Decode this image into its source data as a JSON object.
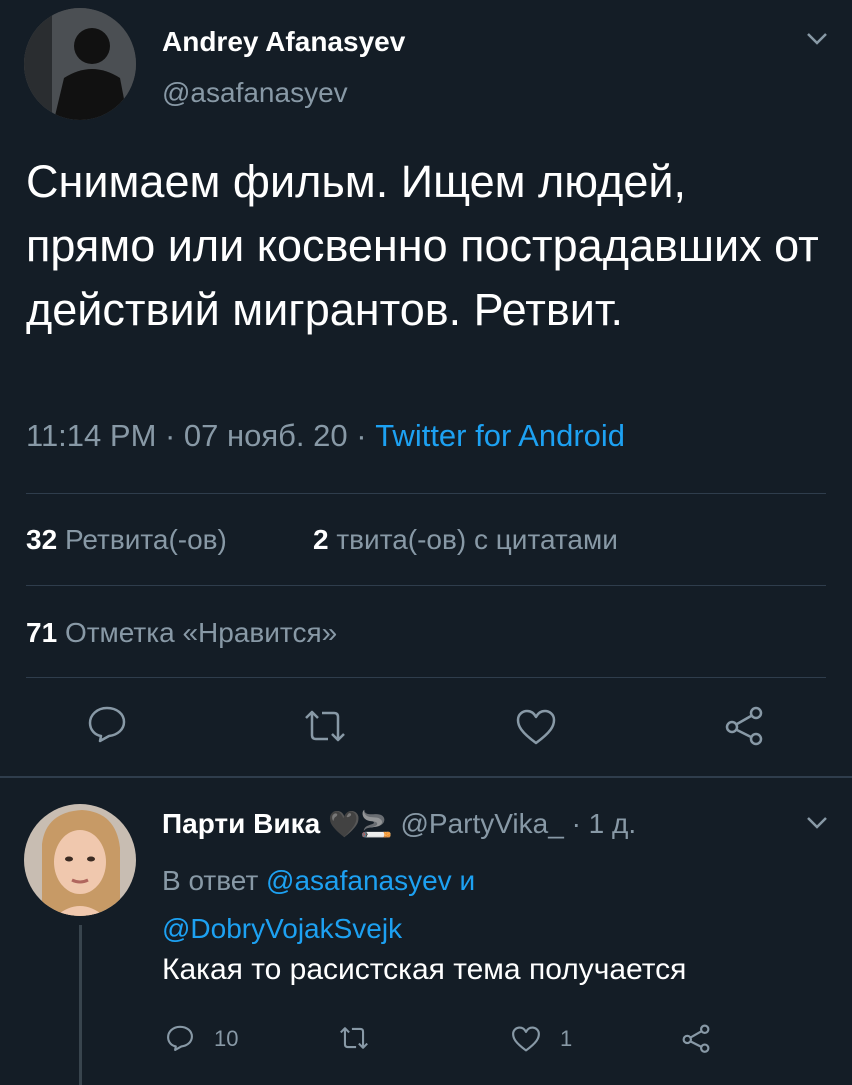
{
  "tweet": {
    "author_name": "Andrey Afanasyev",
    "author_handle": "@asafanasyev",
    "text": "Снимаем фильм. Ищем людей, прямо или косвенно пострадавших от действий мигрантов. Ретвит.",
    "time": "11:14 PM · 07 нояб. 20 · ",
    "source": "Twitter for Android",
    "retweets_count": "32",
    "retweets_label": "Ретвита(-ов)",
    "quotes_count": "2",
    "quotes_label": "твита(-ов) с цитатами",
    "likes_count": "71",
    "likes_label": "Отметка «Нравится»"
  },
  "reply": {
    "author_name": "Парти Вика",
    "emoji": "🖤🚬",
    "author_handle": "@PartyVika_",
    "time": "· 1 д.",
    "reply_prefix": "В ответ",
    "mention1": "@asafanasyev",
    "conj": "и",
    "mention2": "@DobryVojakSvejk",
    "text": "Какая то расистская тема получается",
    "reply_count": "10",
    "like_count": "1"
  },
  "icons": {
    "reply": "reply-icon",
    "retweet": "retweet-icon",
    "like": "heart-icon",
    "share": "share-icon",
    "chevron": "chevron-down-icon"
  },
  "colors": {
    "background": "#141d26",
    "muted": "#8899a6",
    "link": "#1da1f2",
    "divider": "#2f3d4c"
  }
}
